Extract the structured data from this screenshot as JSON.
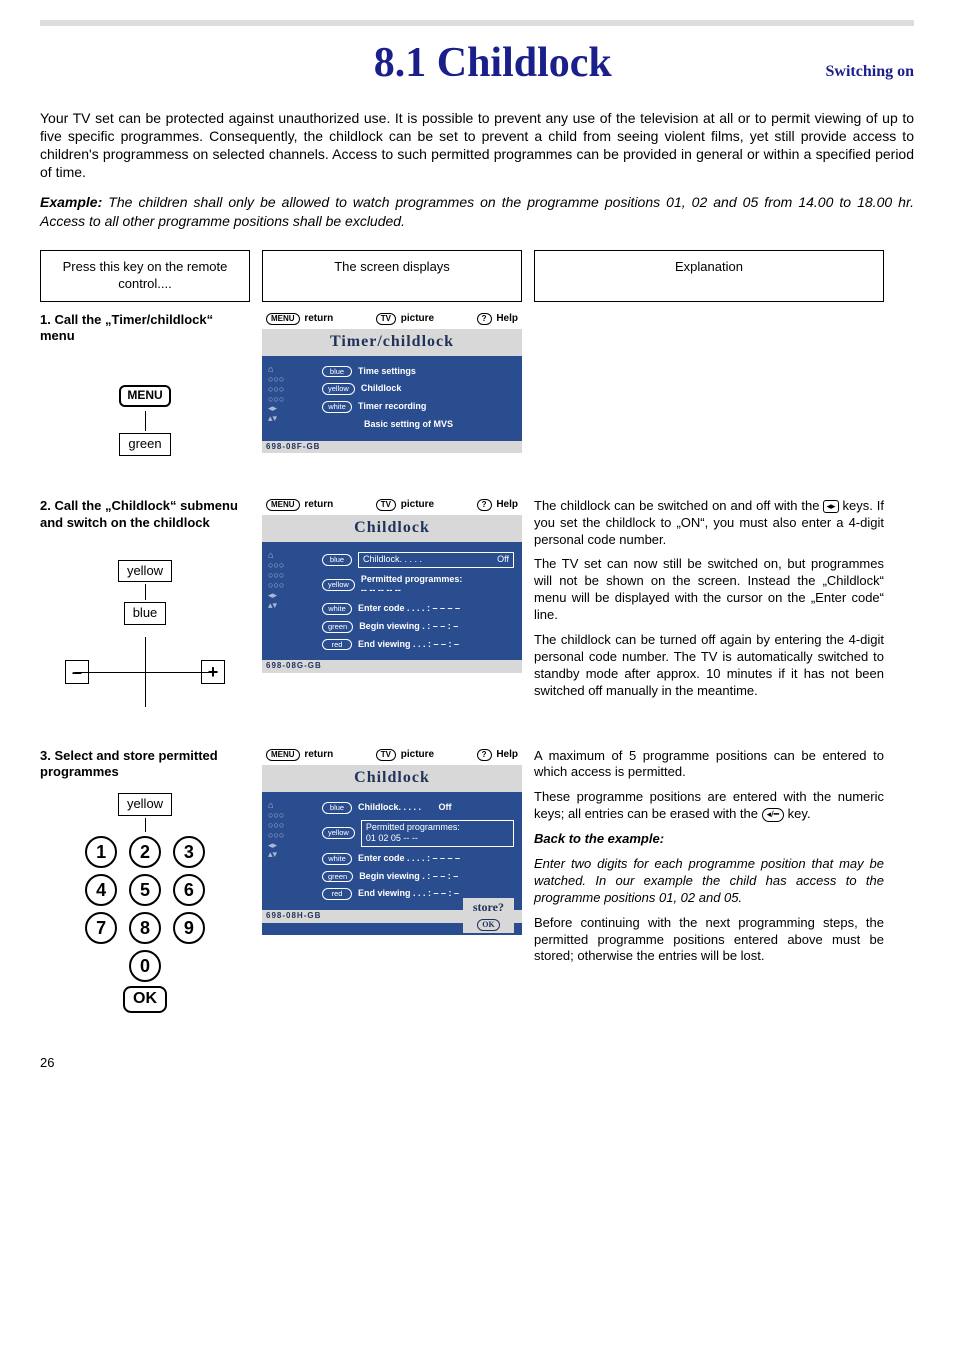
{
  "header": {
    "title": "8.1 Childlock",
    "subtitle": "Switching on"
  },
  "intro": "Your TV set can be protected against unauthorized use. It is possible to prevent any use of the television at all or to permit viewing of up to five specific programmes. Consequently, the childlock can be set to prevent a child from seeing violent films, yet still provide access to children's programmess on selected channels. Access to such permitted programmes can be provided in general or within a specified period of time.",
  "example_label": "Example:",
  "example_text": "The children shall only be allowed to watch programmes on the programme positions 01, 02 and 05 from 14.00 to 18.00 hr. Access to all other programme positions shall be excluded.",
  "colheads": {
    "a": "Press this key on the remote control....",
    "b": "The screen displays",
    "c": "Explanation"
  },
  "steps": {
    "s1": "1. Call the „Timer/childlock“ menu",
    "s2": "2. Call the „Childlock“ submenu and switch on the childlock",
    "s3": "3. Select and store permitted programmes"
  },
  "remote_labels": {
    "menu": "MENU",
    "green": "green",
    "yellow": "yellow",
    "blue": "blue",
    "ok": "OK"
  },
  "osd_common": {
    "return": "return",
    "picture": "picture",
    "help": "Help",
    "menu_pill": "MENU",
    "tv_pill": "TV",
    "q_pill": "?"
  },
  "osd1": {
    "title": "Timer/childlock",
    "r1p": "blue",
    "r1t": "Time settings",
    "r2p": "yellow",
    "r2t": "Childlock",
    "r3p": "white",
    "r3t": "Timer recording",
    "r4t": "Basic setting of MVS",
    "footer": "698-08F-GB"
  },
  "osd2": {
    "title": "Childlock",
    "r1p": "blue",
    "r1l": "Childlock. . . . .",
    "r1v": "Off",
    "r2p": "yellow",
    "r2t": "Permitted programmes:",
    "r2v": "-- -- -- -- --",
    "r3p": "white",
    "r3t": "Enter code . . . . :",
    "r3v": "– – – –",
    "r4p": "green",
    "r4t": "Begin viewing . :",
    "r4v": "– – : –",
    "r5p": "red",
    "r5t": "End viewing . . . :",
    "r5v": "– – : –",
    "footer": "698-08G-GB"
  },
  "osd3": {
    "title": "Childlock",
    "r1p": "blue",
    "r1l": "Childlock. . . . .",
    "r1v": "Off",
    "r2p": "yellow",
    "r2t": "Permitted programmes:",
    "r2v": "01 02 05 -- --",
    "r3p": "white",
    "r3t": "Enter code . . . . :",
    "r3v": "– – – –",
    "r4p": "green",
    "r4t": "Begin viewing . :",
    "r4v": "– – : –",
    "r5p": "red",
    "r5t": "End viewing . . . :",
    "r5v": "– – : –",
    "store": "store?",
    "store_ok": "OK",
    "footer": "698-08H-GB"
  },
  "exp2": {
    "p1a": "The childlock can be switched on and off with the ",
    "p1b": " keys. If you set the childlock to „ON“, you must also enter a 4-digit personal code number.",
    "p2": "The TV set can now still be switched on, but programmes will not be shown on the screen. Instead the „Childlock“ menu will be displayed with the cursor on the „Enter code“ line.",
    "p3": "The childlock can be turned off again by entering the 4-digit personal code number. The TV is automatically switched to standby mode after approx. 10 minutes if it has not been switched off manually in the meantime."
  },
  "exp3": {
    "p1": "A maximum of 5 programme positions can be entered to which access is permitted.",
    "p2a": "These programme positions are entered with the numeric keys; all entries can be erased with the ",
    "p2b": " key.",
    "bte": "Back to the example:",
    "p3": "Enter two digits for each programme position that may be watched. In our example the child has access to the programme positions 01, 02 and 05.",
    "p4": "Before continuing with the next programming steps, the permitted programme positions entered above must be stored; otherwise the entries will be lost."
  },
  "numpad": {
    "k1": "1",
    "k2": "2",
    "k3": "3",
    "k4": "4",
    "k5": "5",
    "k6": "6",
    "k7": "7",
    "k8": "8",
    "k9": "9",
    "k0": "0"
  },
  "page": "26"
}
